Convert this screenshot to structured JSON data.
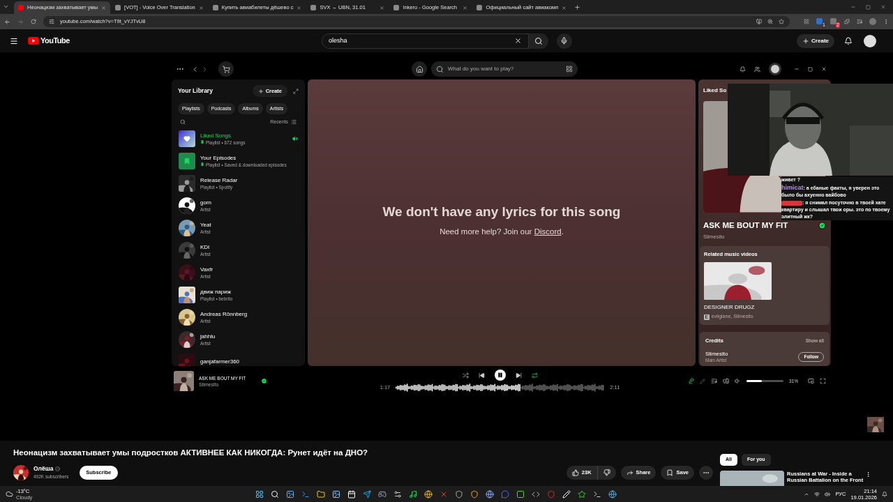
{
  "browser": {
    "tabs": [
      {
        "title": "Неонацизм захватывает умы",
        "selected": true
      },
      {
        "title": "[VOT] - Voice Over Translation",
        "selected": false
      },
      {
        "title": "Купить авиабилеты дёшево с",
        "selected": false
      },
      {
        "title": "SVX → UBN, 31.01",
        "selected": false
      },
      {
        "title": "Inkero - Google Search",
        "selected": false
      },
      {
        "title": "Официальный сайт авиакомп",
        "selected": false
      }
    ],
    "address": "youtube.com/watch?v=T9t_vYJTvU8",
    "extension_badges": [
      "1",
      "2"
    ]
  },
  "youtube": {
    "logo": "YouTube",
    "search_value": "olesha",
    "create": "Create"
  },
  "spotify": {
    "search_placeholder": "What do you want to play?",
    "library": {
      "title": "Your Library",
      "create": "Create",
      "filters": [
        "Playlists",
        "Podcasts",
        "Albums",
        "Artists"
      ],
      "sort": "Recents",
      "items": [
        {
          "kind": "liked",
          "name": "Liked Songs",
          "subtitle": "Playlist • 672 songs",
          "pinned": true,
          "playing": true
        },
        {
          "kind": "episodes",
          "name": "Your Episodes",
          "subtitle": "Playlist • Saved & downloaded episodes",
          "pinned": true,
          "playing": false
        },
        {
          "kind": "playlist",
          "name": "Release Radar",
          "subtitle": "Playlist • Spotify",
          "pinned": false,
          "playing": false
        },
        {
          "kind": "artist",
          "name": "gorn",
          "subtitle": "Artist",
          "pinned": false,
          "playing": false
        },
        {
          "kind": "artist",
          "name": "Yeat",
          "subtitle": "Artist",
          "pinned": false,
          "playing": false
        },
        {
          "kind": "artist",
          "name": "KDI",
          "subtitle": "Artist",
          "pinned": false,
          "playing": false
        },
        {
          "kind": "artist",
          "name": "Vaxfr",
          "subtitle": "Artist",
          "pinned": false,
          "playing": false
        },
        {
          "kind": "playlist",
          "name": "движ париж",
          "subtitle": "Playlist • bebrito",
          "pinned": false,
          "playing": false
        },
        {
          "kind": "artist",
          "name": "Andreas Rönnberg",
          "subtitle": "Artist",
          "pinned": false,
          "playing": false
        },
        {
          "kind": "artist",
          "name": "jahhlu",
          "subtitle": "Artist",
          "pinned": false,
          "playing": false
        },
        {
          "kind": "playlist",
          "name": "ganjafarmer360",
          "playing": false
        }
      ]
    },
    "lyrics": {
      "message": "We don't have any lyrics for this song",
      "help": "Need more help? Join our",
      "link": "Discord",
      "after_link": "."
    },
    "now_playing": {
      "header": "Liked So",
      "title": "ASK ME BOUT MY FIT",
      "artist": "Slimesito",
      "saved": true,
      "related": {
        "heading": "Related music videos",
        "video_title": "DESIGNER DRUGZ",
        "explicit": "E",
        "artists": "evilgiane, Slimesito"
      },
      "credits": {
        "heading": "Credits",
        "show_all": "Show all",
        "name": "Slimesito",
        "role": "Main Artist",
        "follow": "Follow"
      }
    },
    "player": {
      "title": "ASK ME BOUT MY FIT",
      "artist": "Slimesito",
      "saved": true,
      "playing": true,
      "shuffle": false,
      "repeat": true,
      "lyrics_on": true,
      "elapsed": "1:17",
      "total": "2:11",
      "progress": {
        "level": 0.6
      },
      "volume": {
        "level": 0.42
      },
      "volume_text": "31%"
    }
  },
  "stream_chat": [
    {
      "kind": "continuation",
      "text": "живет ?"
    },
    {
      "kind": "message",
      "author": "himicat",
      "color": "#b58cf5",
      "text": ": а ебаные факты, я уверен это было бы ахуенно вайбово"
    },
    {
      "kind": "hidden_author",
      "color": "#d43838",
      "text": ": я снимал посуточно в твоей хате квартиру и слышал твои оры. это по твоему элитный жк?"
    }
  ],
  "video": {
    "title": "Неонацизм захватывает умы подростков АКТИВНЕЕ КАК НИКОГДА: Рунет идёт на ДНО?",
    "channel": "Олёша",
    "verified": true,
    "subscribers": "492K subscribers",
    "subscribe": "Subscribe",
    "likes": "23K",
    "share": "Share",
    "save": "Save"
  },
  "sidebar": {
    "chips": [
      {
        "label": "All",
        "selected": true
      },
      {
        "label": "For you",
        "selected": false
      }
    ],
    "recommended": [
      {
        "title": "Russians at War - Inside a Russian Battalion on the Front"
      }
    ]
  },
  "taskbar": {
    "temperature": "-13°C",
    "weather": "Cloudy",
    "language": "РУС",
    "time": "21:14",
    "date": "19.01.2026"
  }
}
